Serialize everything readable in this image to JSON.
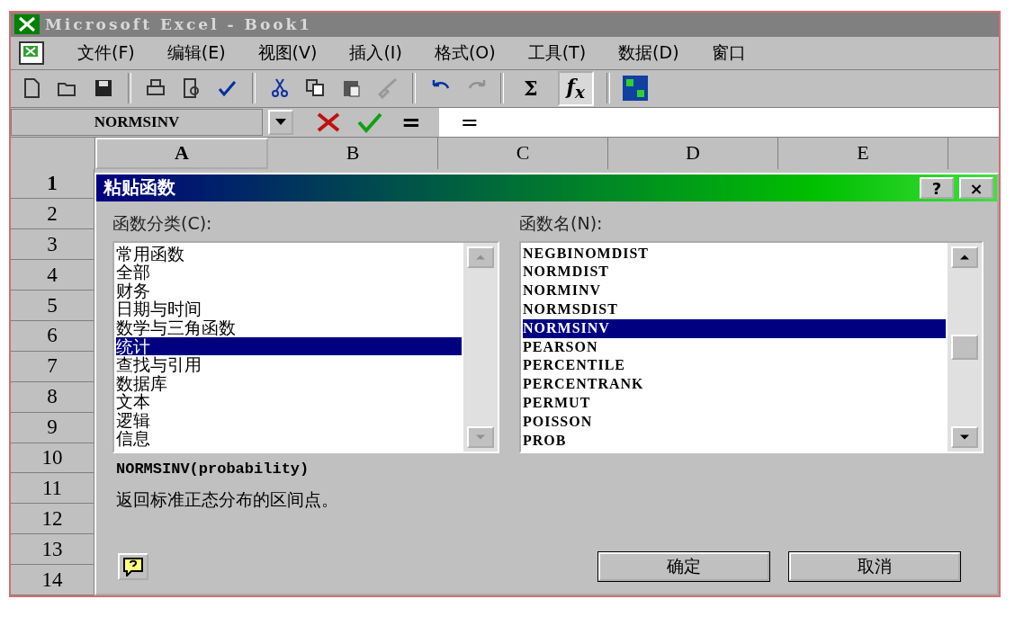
{
  "window": {
    "title": "Microsoft Excel - Book1"
  },
  "menu": [
    "文件(F)",
    "编辑(E)",
    "视图(V)",
    "插入(I)",
    "格式(O)",
    "工具(T)",
    "数据(D)",
    "窗口"
  ],
  "toolbar": {
    "sum": "Σ",
    "function": "f$_{x}$"
  },
  "formula_bar": {
    "name_box": "NORMSINV",
    "equals": "=",
    "value": "="
  },
  "columns": [
    {
      "label": "A",
      "selected": true
    },
    {
      "label": "B",
      "selected": false
    },
    {
      "label": "C",
      "selected": false
    },
    {
      "label": "D",
      "selected": false
    },
    {
      "label": "E",
      "selected": false
    }
  ],
  "rows": [
    {
      "label": "1",
      "selected": true
    },
    {
      "label": "2",
      "selected": false
    },
    {
      "label": "3",
      "selected": false
    },
    {
      "label": "4",
      "selected": false
    },
    {
      "label": "5",
      "selected": false
    },
    {
      "label": "6",
      "selected": false
    },
    {
      "label": "7",
      "selected": false
    },
    {
      "label": "8",
      "selected": false
    },
    {
      "label": "9",
      "selected": false
    },
    {
      "label": "10",
      "selected": false
    },
    {
      "label": "11",
      "selected": false
    },
    {
      "label": "12",
      "selected": false
    },
    {
      "label": "13",
      "selected": false
    },
    {
      "label": "14",
      "selected": false
    }
  ],
  "dialog": {
    "title": "粘贴函数",
    "help": "?",
    "close": "×",
    "category_label": "函数分类(C):",
    "categories": [
      {
        "label": "常用函数",
        "selected": false
      },
      {
        "label": "全部",
        "selected": false
      },
      {
        "label": "财务",
        "selected": false
      },
      {
        "label": "日期与时间",
        "selected": false
      },
      {
        "label": "数学与三角函数",
        "selected": false
      },
      {
        "label": "统计",
        "selected": true
      },
      {
        "label": "查找与引用",
        "selected": false
      },
      {
        "label": "数据库",
        "selected": false
      },
      {
        "label": "文本",
        "selected": false
      },
      {
        "label": "逻辑",
        "selected": false
      },
      {
        "label": "信息",
        "selected": false
      }
    ],
    "function_label": "函数名(N):",
    "functions": [
      {
        "label": "NEGBINOMDIST",
        "selected": false
      },
      {
        "label": "NORMDIST",
        "selected": false
      },
      {
        "label": "NORMINV",
        "selected": false
      },
      {
        "label": "NORMSDIST",
        "selected": false
      },
      {
        "label": "NORMSINV",
        "selected": true
      },
      {
        "label": "PEARSON",
        "selected": false
      },
      {
        "label": "PERCENTILE",
        "selected": false
      },
      {
        "label": "PERCENTRANK",
        "selected": false
      },
      {
        "label": "PERMUT",
        "selected": false
      },
      {
        "label": "POISSON",
        "selected": false
      },
      {
        "label": "PROB",
        "selected": false
      }
    ],
    "signature": "NORMSINV(probability)",
    "description": "返回标准正态分布的区间点。",
    "buttons": [
      "确定",
      "取消"
    ]
  }
}
